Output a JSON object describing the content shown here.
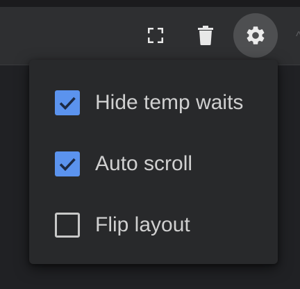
{
  "toolbar": {
    "buttons": [
      {
        "icon": "fullscreen-icon"
      },
      {
        "icon": "trash-icon"
      },
      {
        "icon": "gear-icon",
        "active": true
      }
    ]
  },
  "settings_menu": {
    "items": [
      {
        "label": "Hide temp waits",
        "checked": true
      },
      {
        "label": "Auto scroll",
        "checked": true
      },
      {
        "label": "Flip layout",
        "checked": false
      }
    ]
  },
  "colors": {
    "accent": "#5b93ee",
    "menu_bg": "#28292b",
    "toolbar_bg": "#2e2f31",
    "text": "#d0d0d0"
  }
}
